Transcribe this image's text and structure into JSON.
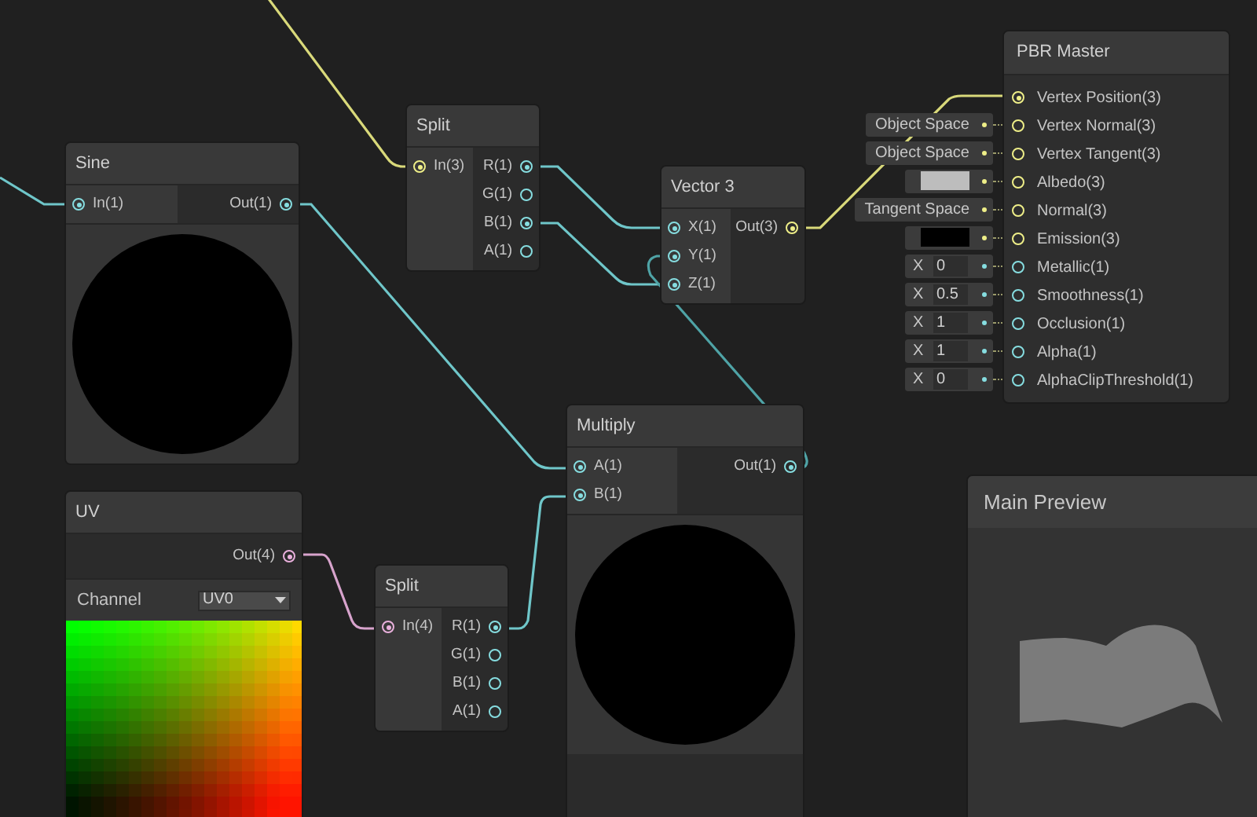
{
  "nodes": [
    {
      "kind": "sine",
      "title": "Sine",
      "inputs": [
        {
          "label": "In(1)",
          "connected": true,
          "color": "#86dde0"
        }
      ],
      "outputs": [
        {
          "label": "Out(1)",
          "connected": true,
          "color": "#86dde0"
        }
      ]
    },
    {
      "kind": "split",
      "title": "Split",
      "inputs": [
        {
          "label": "In(3)",
          "connected": true,
          "color": "#eeee88"
        }
      ],
      "outputs": [
        {
          "label": "R(1)",
          "connected": true,
          "color": "#86dde0"
        },
        {
          "label": "G(1)",
          "connected": false,
          "color": "#86dde0"
        },
        {
          "label": "B(1)",
          "connected": true,
          "color": "#86dde0"
        },
        {
          "label": "A(1)",
          "connected": false,
          "color": "#86dde0"
        }
      ]
    },
    {
      "kind": "vector",
      "title": "Vector 3",
      "inputs": [
        {
          "label": "X(1)",
          "connected": true,
          "color": "#86dde0"
        },
        {
          "label": "Y(1)",
          "connected": true,
          "color": "#86dde0"
        },
        {
          "label": "Z(1)",
          "connected": true,
          "color": "#86dde0"
        }
      ],
      "outputs": [
        {
          "label": "Out(3)",
          "connected": true,
          "color": "#eeee88"
        }
      ]
    },
    {
      "kind": "multiply",
      "title": "Multiply",
      "inputs": [
        {
          "label": "A(1)",
          "connected": true,
          "color": "#86dde0"
        },
        {
          "label": "B(1)",
          "connected": true,
          "color": "#86dde0"
        }
      ],
      "outputs": [
        {
          "label": "Out(1)",
          "connected": true,
          "color": "#86dde0"
        }
      ]
    },
    {
      "kind": "uv",
      "title": "UV",
      "outputs": [
        {
          "label": "Out(4)",
          "connected": true,
          "color": "#e9b0dc"
        }
      ],
      "channel": {
        "label": "Channel",
        "value": "UV0"
      }
    },
    {
      "kind": "split",
      "title": "Split",
      "inputs": [
        {
          "label": "In(4)",
          "connected": true,
          "color": "#e9b0dc"
        }
      ],
      "outputs": [
        {
          "label": "R(1)",
          "connected": true,
          "color": "#86dde0"
        },
        {
          "label": "G(1)",
          "connected": false,
          "color": "#86dde0"
        },
        {
          "label": "B(1)",
          "connected": false,
          "color": "#86dde0"
        },
        {
          "label": "A(1)",
          "connected": false,
          "color": "#86dde0"
        }
      ]
    }
  ],
  "master": {
    "title": "PBR Master",
    "inputs": [
      {
        "label": "Vertex Position(3)",
        "connected": true,
        "color": "#eeee88"
      },
      {
        "label": "Vertex Normal(3)",
        "connected": false,
        "color": "#eeee88",
        "field": {
          "kind": "space",
          "text": "Object Space"
        }
      },
      {
        "label": "Vertex Tangent(3)",
        "connected": false,
        "color": "#eeee88",
        "field": {
          "kind": "space",
          "text": "Object Space"
        }
      },
      {
        "label": "Albedo(3)",
        "connected": false,
        "color": "#eeee88",
        "field": {
          "kind": "swatch",
          "color": "#bdbdbd"
        }
      },
      {
        "label": "Normal(3)",
        "connected": false,
        "color": "#eeee88",
        "field": {
          "kind": "space",
          "text": "Tangent Space"
        }
      },
      {
        "label": "Emission(3)",
        "connected": false,
        "color": "#eeee88",
        "field": {
          "kind": "swatch",
          "color": "#000000"
        }
      },
      {
        "label": "Metallic(1)",
        "connected": false,
        "color": "#86dde0",
        "field": {
          "kind": "number",
          "axis": "X",
          "value": "0"
        }
      },
      {
        "label": "Smoothness(1)",
        "connected": false,
        "color": "#86dde0",
        "field": {
          "kind": "number",
          "axis": "X",
          "value": "0.5"
        }
      },
      {
        "label": "Occlusion(1)",
        "connected": false,
        "color": "#86dde0",
        "field": {
          "kind": "number",
          "axis": "X",
          "value": "1"
        }
      },
      {
        "label": "Alpha(1)",
        "connected": false,
        "color": "#86dde0",
        "field": {
          "kind": "number",
          "axis": "X",
          "value": "1"
        }
      },
      {
        "label": "AlphaClipThreshold(1)",
        "connected": false,
        "color": "#86dde0",
        "field": {
          "kind": "number",
          "axis": "X",
          "value": "0"
        }
      }
    ]
  },
  "main_preview": {
    "title": "Main Preview"
  }
}
